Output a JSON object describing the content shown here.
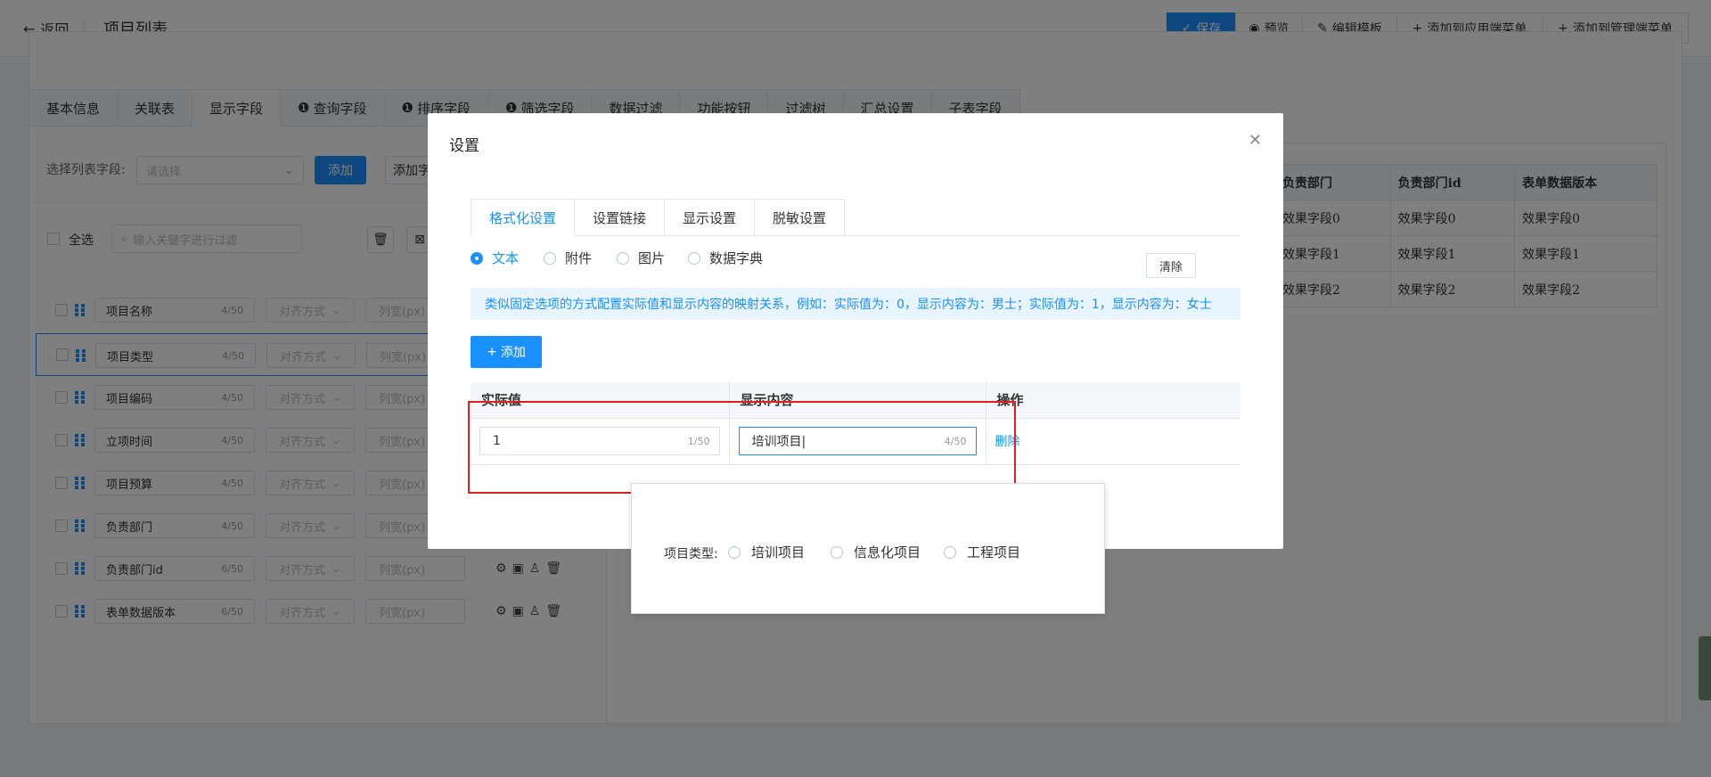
{
  "header": {
    "back_label": "返回",
    "title": "项目列表",
    "buttons": {
      "save": "保存",
      "preview": "预览",
      "edit_template": "编辑模板",
      "add_app_menu": "添加到应用端菜单",
      "add_admin_menu": "添加到管理端菜单"
    }
  },
  "tabs": [
    {
      "label": "基本信息"
    },
    {
      "label": "关联表"
    },
    {
      "label": "显示字段"
    },
    {
      "label": "查询字段"
    },
    {
      "label": "排序字段"
    },
    {
      "label": "筛选字段"
    },
    {
      "label": "数据过滤"
    },
    {
      "label": "功能按钮"
    },
    {
      "label": "过滤树"
    },
    {
      "label": "汇总设置"
    },
    {
      "label": "子表字段"
    }
  ],
  "field_panel": {
    "select_label": "选择列表字段:",
    "select_placeholder": "请选择",
    "add_label": "添加",
    "add_all_label": "添加字",
    "select_all": "全选",
    "filter_placeholder": "输入关键字进行过滤",
    "align_placeholder": "对齐方式",
    "width_placeholder": "列宽(px)",
    "rows": [
      {
        "name": "项目名称",
        "count": "4/50"
      },
      {
        "name": "项目类型",
        "count": "4/50"
      },
      {
        "name": "项目编码",
        "count": "4/50"
      },
      {
        "name": "立项时间",
        "count": "4/50"
      },
      {
        "name": "项目预算",
        "count": "4/50"
      },
      {
        "name": "负责部门",
        "count": "4/50"
      },
      {
        "name": "负责部门id",
        "count": "6/50"
      },
      {
        "name": "表单数据版本",
        "count": "6/50"
      }
    ]
  },
  "preview_table": {
    "headers": [
      "负责部门",
      "负责部门id",
      "表单数据版本"
    ],
    "rows": [
      [
        "效果字段0",
        "效果字段0",
        "效果字段0"
      ],
      [
        "效果字段1",
        "效果字段1",
        "效果字段1"
      ],
      [
        "效果字段2",
        "效果字段2",
        "效果字段2"
      ]
    ]
  },
  "modal": {
    "title": "设置",
    "tabs": [
      "格式化设置",
      "设置链接",
      "显示设置",
      "脱敏设置"
    ],
    "radio_options": [
      "文本",
      "附件",
      "图片",
      "数据字典"
    ],
    "clear_label": "清除",
    "tip": "类似固定选项的方式配置实际值和显示内容的映射关系，例如：实际值为：0，显示内容为：男士；实际值为：1，显示内容为：女士",
    "add_label": "添加",
    "table_headers": [
      "实际值",
      "显示内容",
      "操作"
    ],
    "row": {
      "actual_value": "1",
      "actual_count": "1/50",
      "display_value": "培训项目",
      "display_count": "4/50",
      "delete_label": "删除"
    }
  },
  "popup": {
    "label": "项目类型:",
    "options": [
      "培训项目",
      "信息化项目",
      "工程项目"
    ]
  },
  "colors": {
    "primary": "#1890ff",
    "highlight": "#e02020"
  }
}
